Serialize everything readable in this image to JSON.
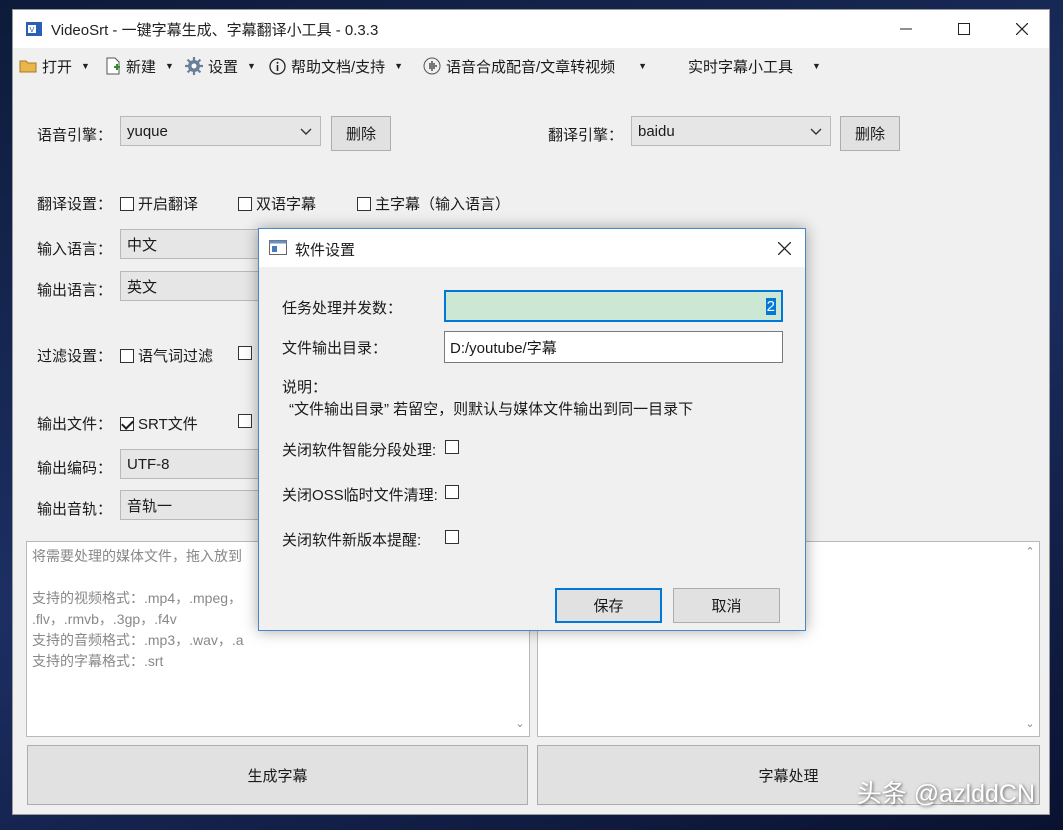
{
  "window": {
    "title": "VideoSrt - 一键字幕生成、字幕翻译小工具 - 0.3.3"
  },
  "menu": {
    "open": "打开",
    "new": "新建",
    "settings": "设置",
    "help": "帮助文档/支持",
    "tts": "语音合成配音/文章转视频",
    "realtime": "实时字幕小工具"
  },
  "main": {
    "speech_engine_label": "语音引擎：",
    "speech_engine_value": "yuque",
    "delete_label": "删除",
    "translate_engine_label": "翻译引擎：",
    "translate_engine_value": "baidu",
    "translate_settings_label": "翻译设置：",
    "enable_translate": "开启翻译",
    "bilingual": "双语字幕",
    "main_subtitle": "主字幕（输入语言）",
    "input_language_label": "输入语言：",
    "input_language_value": "中文",
    "output_language_label": "输出语言：",
    "output_language_value": "英文",
    "filter_settings_label": "过滤设置：",
    "filler_filter": "语气词过滤",
    "output_file_label": "输出文件：",
    "srt_file": "SRT文件",
    "output_encoding_label": "输出编码：",
    "output_encoding_value": "UTF-8",
    "output_track_label": "输出音轨：",
    "output_track_value": "音轨一",
    "drop_hint_lines": [
      "将需要处理的媒体文件，拖入放到",
      "",
      "支持的视频格式：.mp4，.mpeg，",
      ".flv，.rmvb，.3gp，.f4v",
      "支持的音频格式：.mp3，.wav，.a",
      "支持的字幕格式：.srt"
    ],
    "generate_button": "生成字幕",
    "process_button": "字幕处理"
  },
  "dialog": {
    "title": "软件设置",
    "concurrency_label": "任务处理并发数：",
    "concurrency_value": "2",
    "output_dir_label": "文件输出目录：",
    "output_dir_value": "D:/youtube/字幕",
    "note_title": "说明：",
    "note_text": "“文件输出目录” 若留空，则默认与媒体文件输出到同一目录下",
    "disable_smart_segment": "关闭软件智能分段处理:",
    "disable_oss_cleanup": "关闭OSS临时文件清理:",
    "disable_update_notice": "关闭软件新版本提醒:",
    "save_button": "保存",
    "cancel_button": "取消"
  },
  "watermark": "头条 @azlddCN",
  "colors": {
    "highlight_field": "#cce8d4",
    "selection": "#0078d7",
    "dialog_border": "#4a86c8"
  }
}
